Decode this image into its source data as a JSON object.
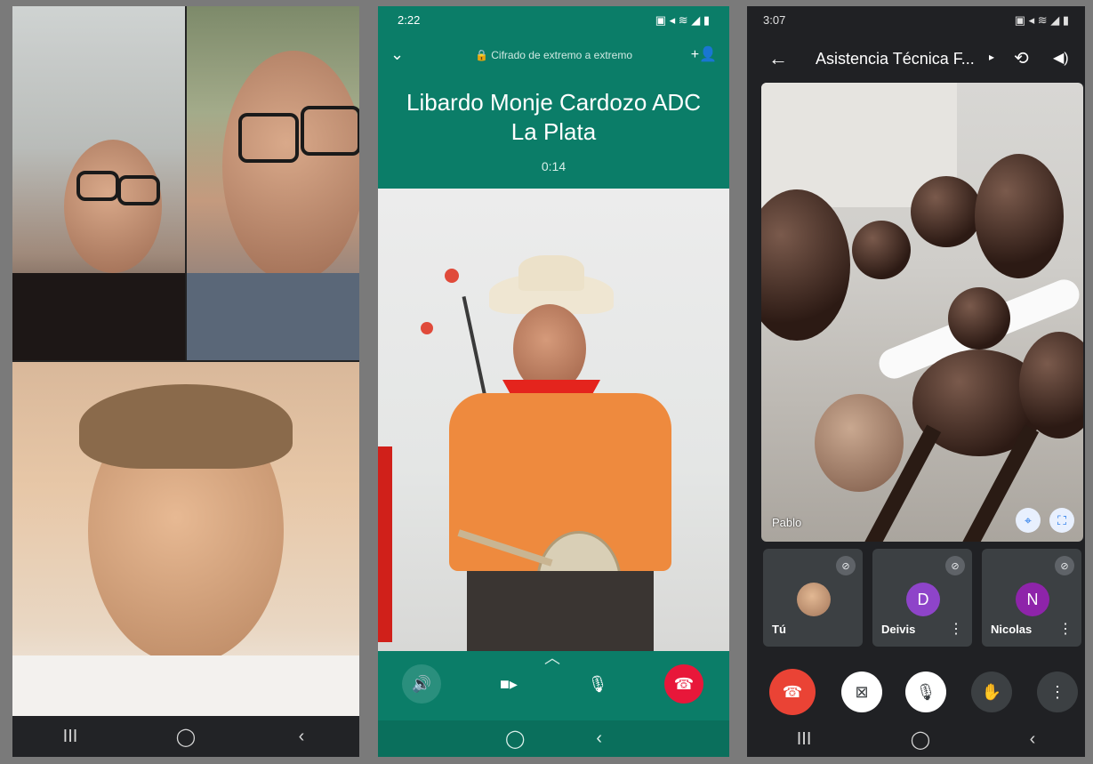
{
  "phone1": {
    "nav": {
      "recent": "III",
      "home": "◯",
      "back": "‹"
    }
  },
  "phone2": {
    "status": {
      "time": "2:22",
      "icons": "▣ ◂ ≋ ◢ ▮"
    },
    "encryption": "🔒 Cifrado de extremo a extremo",
    "contact_name_line1": "Libardo Monje Cardozo ADC",
    "contact_name_line2": "La Plata",
    "timer": "0:14",
    "nav": {
      "home": "◯",
      "back": "‹"
    },
    "colors": {
      "header": "#0b7d68",
      "end_call": "#e8173a"
    }
  },
  "phone3": {
    "status": {
      "time": "3:07",
      "icons": "▣ ◂ ≋ ◢ ▮"
    },
    "title": "Asistencia Técnica F...",
    "main_participant": "Pablo",
    "participants": [
      {
        "name": "Tú",
        "initial": "",
        "color": "#c9a27e"
      },
      {
        "name": "Deivis",
        "initial": "D",
        "color": "#8e44c9"
      },
      {
        "name": "Nicolas",
        "initial": "N",
        "color": "#8e24aa"
      }
    ],
    "nav": {
      "recent": "III",
      "home": "◯",
      "back": "‹"
    },
    "colors": {
      "end_call": "#ea4335"
    }
  }
}
